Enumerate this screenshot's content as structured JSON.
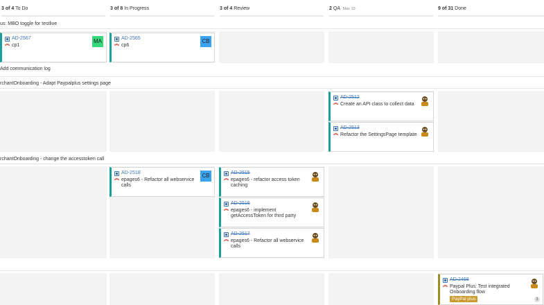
{
  "columns": [
    {
      "count": "3 of 4",
      "name": "To Do",
      "max": ""
    },
    {
      "count": "3 of 8",
      "name": "In Progress",
      "max": ""
    },
    {
      "count": "3 of 4",
      "name": "Review",
      "max": ""
    },
    {
      "count": "2",
      "name": "QA",
      "max": "Max 10"
    },
    {
      "count": "9 of 31",
      "name": "Done",
      "max": ""
    }
  ],
  "swimlanes": [
    {
      "label": "us: MBO toggle for testlive"
    },
    {
      "label": "Add communication log"
    },
    {
      "label": "rchantOnboarding - Adapt Paypalplus settings page"
    },
    {
      "label": "rchantOnboarding - change the accesstoken call"
    }
  ],
  "cards": [
    {
      "key": "AD-2567",
      "summary": "cp1",
      "avatar": "MA"
    },
    {
      "key": "AD-2565",
      "summary": "cp6",
      "avatar": "CB"
    },
    {
      "key": "AD-2512",
      "summary": "Create an API class to collect data"
    },
    {
      "key": "AD-2513",
      "summary": "Refactor the SettingsPage template"
    },
    {
      "key": "AD-2518",
      "summary": "epages6 - Refactor all webservice calls",
      "avatar": "CB"
    },
    {
      "key": "AD-2515",
      "summary": "epages6 - refactor access token caching"
    },
    {
      "key": "AD-2516",
      "summary": "epages6 - implement getAccessToken for third party"
    },
    {
      "key": "AD-2517",
      "summary": "epages6 - Refactor all webservice calls"
    },
    {
      "key": "AD-2468",
      "summary": "Paypal Plus: Test integrated Onboarding flow",
      "badge": "PayPal plus",
      "count": "3"
    }
  ],
  "colors": {
    "accent": "#1a9e9c",
    "done_accent": "#9e8e2a",
    "link": "#3b73b9",
    "priority": "#d04437"
  }
}
